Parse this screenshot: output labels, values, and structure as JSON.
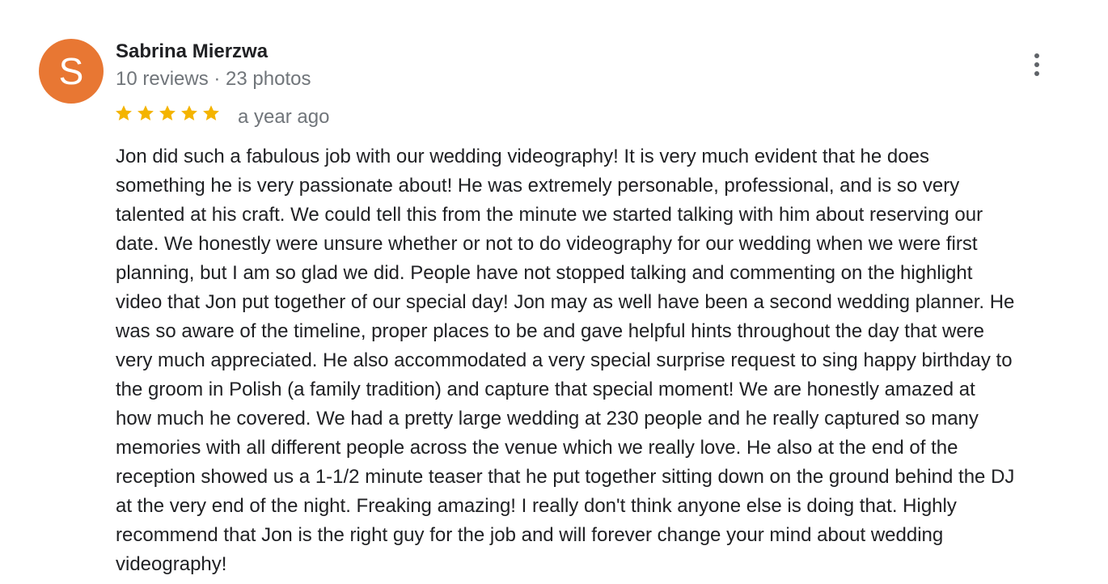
{
  "review": {
    "author": {
      "initial": "S",
      "name": "Sabrina Mierzwa",
      "meta": "10 reviews · 23 photos",
      "avatar_color": "#e87733"
    },
    "rating": 5,
    "star_color": "#f4b400",
    "date": "a year ago",
    "menu_icon": "more-vertical-icon",
    "text_lines": [
      "Jon did such a fabulous job with our wedding videography! It is very much evident that he does",
      "something he is very passionate about! He was extremely personable, professional, and is so very",
      "talented at his craft. We could tell this from the minute we started talking with him about reserving our",
      "date. We honestly were unsure whether or not to do videography for our wedding when we were first",
      "planning, but I am so glad we did. People have not stopped talking and commenting on the highlight",
      "video that Jon put together of our special day! Jon may as well have been a second wedding planner. He",
      "was so aware of the timeline, proper places to be and gave helpful hints throughout the day that were",
      "very much appreciated. He also accommodated a very special surprise request to sing happy birthday to",
      "the groom in Polish (a family tradition) and capture that special moment! We are honestly amazed at",
      "how much he covered. We had a pretty large wedding at 230 people and he really captured so many",
      "memories with all different people across the venue which we really love. He also at the end of the",
      "reception showed us a 1-1/2 minute teaser that he put together sitting down on the ground behind the DJ",
      "at the very end of the night. Freaking amazing! I really don't think anyone else is doing that. Highly",
      "recommend that Jon is the right guy for the job and will forever change your mind about wedding",
      "videography!"
    ]
  }
}
